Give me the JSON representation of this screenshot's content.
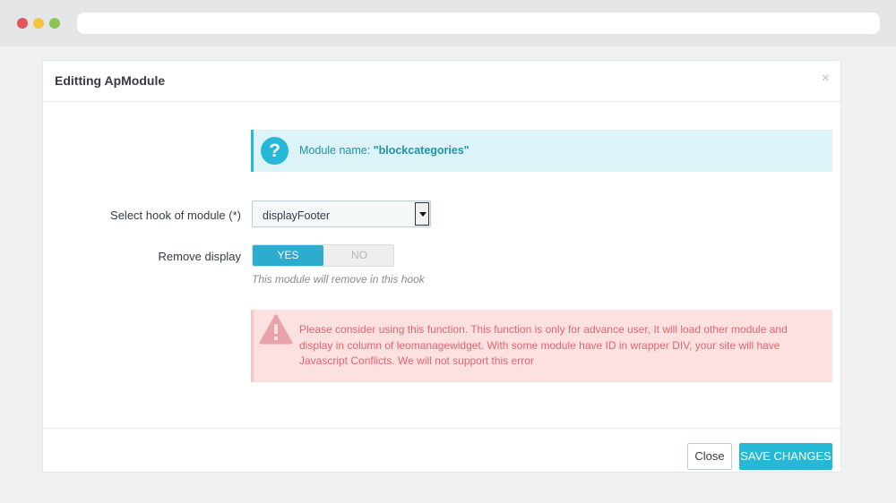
{
  "modal": {
    "title": "Editting ApModule",
    "close_glyph": "×"
  },
  "info": {
    "icon": "question-icon",
    "prefix": "Module name: ",
    "module_name": "\"blockcategories\""
  },
  "hook": {
    "label": "Select hook of module (*)",
    "selected": "displayFooter"
  },
  "remove_display": {
    "label": "Remove display",
    "yes": "YES",
    "no": "NO",
    "value": "YES",
    "help": "This module will remove in this hook"
  },
  "warning": {
    "icon": "warning-icon",
    "text": "Please consider using this function. This function is only for advance user, It will load other module and display in column of leomanagewidget. With some module have ID in wrapper DIV, your site will have Javascript Conflicts. We will not support this error"
  },
  "footer": {
    "close_label": "Close",
    "save_label": "SAVE CHANGES"
  },
  "colors": {
    "accent": "#25b9d7",
    "toggle_on": "#2eacce",
    "warning_bg": "#fde1e1",
    "warning_text": "#e0666f"
  }
}
